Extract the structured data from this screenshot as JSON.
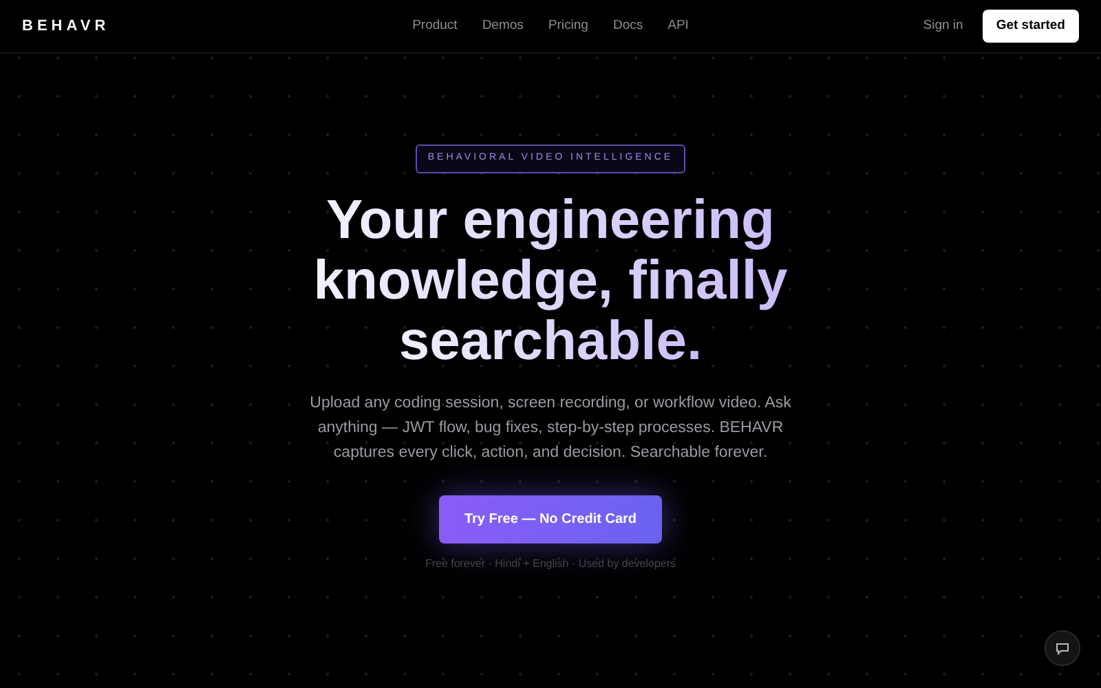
{
  "brand": "BEHAVR",
  "nav": [
    {
      "label": "Product"
    },
    {
      "label": "Demos"
    },
    {
      "label": "Pricing"
    },
    {
      "label": "Docs"
    },
    {
      "label": "API"
    }
  ],
  "sign_in": "Sign in",
  "cta_top": "Get started",
  "hero": {
    "eyebrow": "BEHAVIORAL VIDEO INTELLIGENCE",
    "headline": [
      "Your engineering",
      "knowledge, finally",
      "searchable."
    ],
    "description": "Upload any coding session, screen recording, or workflow video. Ask anything — JWT flow, bug fixes, step-by-step processes. BEHAVR captures every click, action, and decision. Searchable forever.",
    "button": "Try Free — No Credit Card",
    "note": "Free forever · Hindi + English · Used by developers"
  }
}
